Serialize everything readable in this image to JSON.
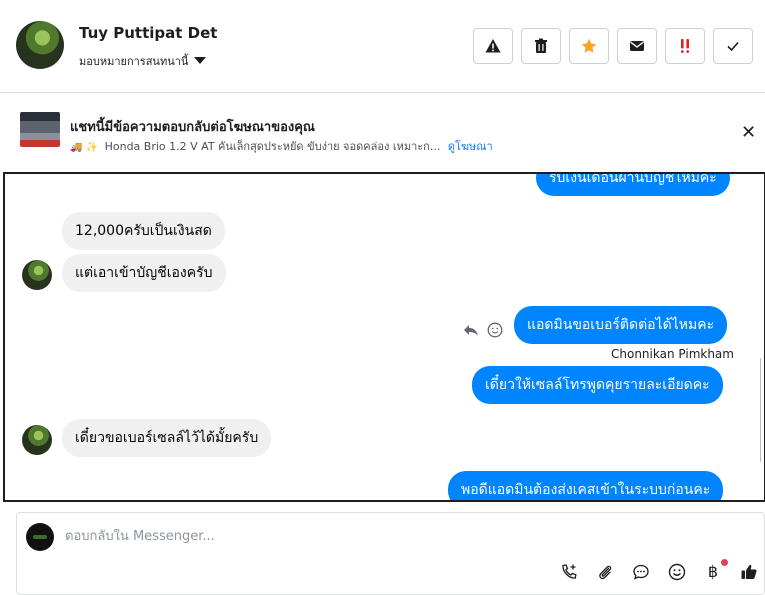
{
  "header": {
    "name": "Tuy Puttipat Det",
    "assign_label": "มอบหมายการสนทนานี้",
    "actions": [
      {
        "icon": "warning-icon"
      },
      {
        "icon": "trash-icon"
      },
      {
        "icon": "star-icon",
        "color": "#f5a623"
      },
      {
        "icon": "mail-icon"
      },
      {
        "icon": "exclamation-icon",
        "color": "#e02020"
      },
      {
        "icon": "check-icon"
      }
    ]
  },
  "ad": {
    "title": "แชทนี้มีข้อความตอบกลับต่อโฆษณาของคุณ",
    "emojis": "🚚 ✨",
    "description": "Honda Brio 1.2 V AT คันเล็กสุดประหยัด ขับง่าย จอดคล่อง เหมาะก...",
    "link_label": "ดูโฆษณา",
    "close_icon": "close-icon"
  },
  "thread": {
    "messages": [
      {
        "direction": "out",
        "text": "รับเงินเดือนผ่านบัญชีไหมคะ"
      },
      {
        "direction": "in",
        "text": "12,000ครับเป็นเงินสด"
      },
      {
        "direction": "in",
        "text": "แต่เอาเข้าบัญชีเองครับ"
      },
      {
        "direction": "out",
        "text": "แอดมินขอเบอร์ติดต่อได้ไหมคะ",
        "sender": "Chonnikan Pimkham"
      },
      {
        "direction": "out",
        "text": "เดี๋ยวให้เซลล์โทรพูดคุยรายละเอียดคะ"
      },
      {
        "direction": "in",
        "text": "เดี๋ยวขอเบอร์เซลล์ไว้ได้มั้ยครับ"
      },
      {
        "direction": "out",
        "text": "พอดีแอดมินต้องส่งเคสเข้าในระบบก่อนคะ"
      }
    ],
    "colors": {
      "outgoing": "#0084ff",
      "incoming": "#f0f0f0"
    }
  },
  "composer": {
    "placeholder": "ตอบกลับใน Messenger...",
    "tools": [
      "call-plus-icon",
      "attachment-icon",
      "saved-reply-icon",
      "emoji-icon",
      "payment-baht-icon",
      "thumbs-up-icon"
    ],
    "baht_symbol": "฿"
  }
}
